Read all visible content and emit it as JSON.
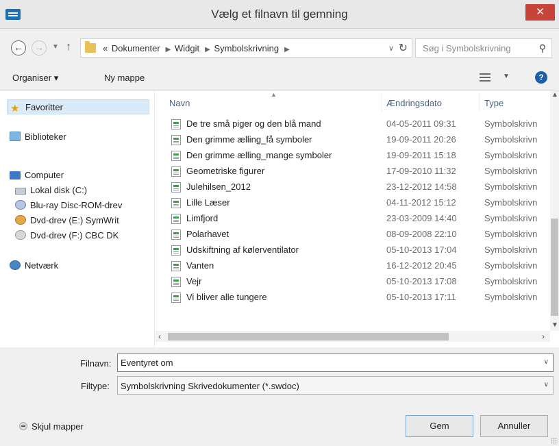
{
  "window": {
    "title": "Vælg et filnavn til gemning",
    "close_label": "✕"
  },
  "address": {
    "breadcrumb": [
      "«",
      "Dokumenter",
      "Widgit",
      "Symbolskrivning"
    ],
    "search_placeholder": "Søg i Symbolskrivning"
  },
  "toolbar": {
    "organise_label": "Organiser ▾",
    "new_folder_label": "Ny mappe"
  },
  "navpane": {
    "items": [
      {
        "label": "Favoritter",
        "icon": "star-icon"
      },
      {
        "label": "Biblioteker",
        "icon": "library-icon"
      },
      {
        "label": "Computer",
        "icon": "computer-icon"
      },
      {
        "label": "Lokal disk (C:)",
        "icon": "hard-drive-icon"
      },
      {
        "label": "Blu-ray Disc-ROM-drev",
        "icon": "disc-drive-icon"
      },
      {
        "label": "Dvd-drev (E:) SymWrit",
        "icon": "dvd-drive-icon"
      },
      {
        "label": "Dvd-drev (F:) CBC DK",
        "icon": "dvd-drive-icon"
      },
      {
        "label": "Netværk",
        "icon": "network-icon"
      }
    ]
  },
  "filelist": {
    "columns": [
      "Navn",
      "Ændringsdato",
      "Type"
    ],
    "rows": [
      {
        "name": "De tre små piger og den blå mand",
        "date": "04-05-2011 09:31",
        "type": "Symbolskrivn"
      },
      {
        "name": "Den grimme ælling_få symboler",
        "date": "19-09-2011 20:26",
        "type": "Symbolskrivn"
      },
      {
        "name": "Den grimme ælling_mange symboler",
        "date": "19-09-2011 15:18",
        "type": "Symbolskrivn"
      },
      {
        "name": "Geometriske figurer",
        "date": "17-09-2010 11:32",
        "type": "Symbolskrivn"
      },
      {
        "name": "Julehilsen_2012",
        "date": "23-12-2012 14:58",
        "type": "Symbolskrivn"
      },
      {
        "name": "Lille Læser",
        "date": "04-11-2012 15:12",
        "type": "Symbolskrivn"
      },
      {
        "name": "Limfjord",
        "date": "23-03-2009 14:40",
        "type": "Symbolskrivn"
      },
      {
        "name": "Polarhavet",
        "date": "08-09-2008 22:10",
        "type": "Symbolskrivn"
      },
      {
        "name": "Udskiftning af kølerventilator",
        "date": "05-10-2013 17:04",
        "type": "Symbolskrivn"
      },
      {
        "name": "Vanten",
        "date": "16-12-2012 20:45",
        "type": "Symbolskrivn"
      },
      {
        "name": "Vejr",
        "date": "05-10-2013 17:08",
        "type": "Symbolskrivn"
      },
      {
        "name": "Vi bliver alle tungere",
        "date": "05-10-2013 17:11",
        "type": "Symbolskrivn"
      }
    ]
  },
  "form": {
    "filename_label": "Filnavn:",
    "filename_value": "Eventyret om",
    "filetype_label": "Filtype:",
    "filetype_value": "Symbolskrivning Skrivedokumenter (*.swdoc)"
  },
  "footer": {
    "hide_folders_label": "Skjul mapper",
    "save_label": "Gem",
    "cancel_label": "Annuller"
  },
  "colors": {
    "close_button": "#c7443b",
    "selection": "#dbeaf7",
    "header_text": "#4c607a"
  }
}
